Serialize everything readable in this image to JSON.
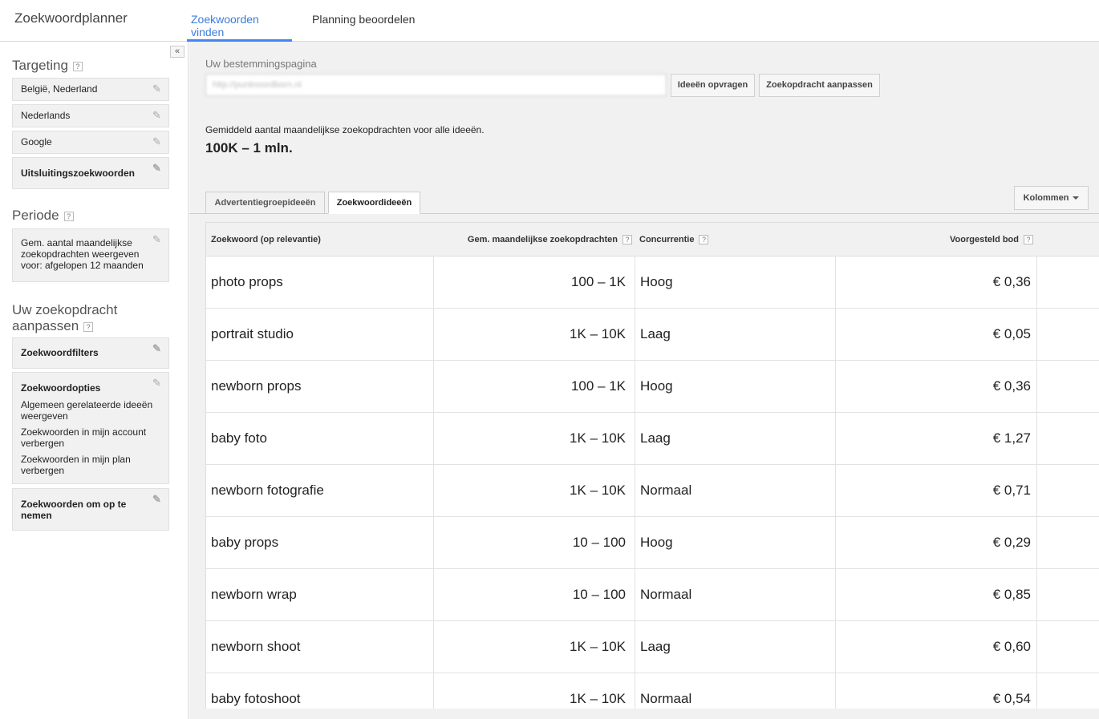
{
  "header": {
    "app_title": "Zoekwoordplanner",
    "tabs": [
      {
        "label": "Zoekwoorden vinden",
        "active": true
      },
      {
        "label": "Planning beoordelen",
        "active": false
      }
    ]
  },
  "sidebar": {
    "collapse_label": "«",
    "targeting": {
      "title": "Targeting",
      "help": "?",
      "items": [
        "België, Nederland",
        "Nederlands",
        "Google",
        "Uitsluitingszoekwoorden"
      ]
    },
    "period": {
      "title": "Periode",
      "help": "?",
      "lines": [
        "Gem. aantal maandelijkse",
        "zoekopdrachten weergeven",
        "voor: afgelopen 12 maanden"
      ]
    },
    "adjust": {
      "title_line1": "Uw zoekopdracht",
      "title_line2": "aanpassen",
      "help": "?",
      "filters_label": "Zoekwoordfilters",
      "options_label": "Zoekwoordopties",
      "options_lines": [
        [
          "Algemeen gerelateerde ideeën",
          "weergeven"
        ],
        [
          "Zoekwoorden in mijn account",
          "verbergen"
        ],
        [
          "Zoekwoorden in mijn plan",
          "verbergen"
        ]
      ],
      "include_line1": "Zoekwoorden om op te",
      "include_line2": "nemen"
    },
    "pencil_icon": "✎"
  },
  "main": {
    "landing_label": "Uw bestemmingspagina",
    "landing_value": "http://puntnoordborn.nl",
    "get_ideas_button": "Ideeën opvragen",
    "adjust_search_button": "Zoekopdracht aanpassen",
    "avg_label": "Gemiddeld aantal maandelijkse zoekopdrachten voor alle ideeën.",
    "avg_value": "100K – 1 mln.",
    "subtabs": [
      {
        "label": "Advertentiegroepideeën",
        "active": false
      },
      {
        "label": "Zoekwoordideeën",
        "active": true
      }
    ],
    "columns_button": "Kolommen"
  },
  "table": {
    "headers": {
      "keyword": "Zoekwoord (op relevantie)",
      "volume": "Gem. maandelijkse zoekopdrachten",
      "competition": "Concurrentie",
      "bid": "Voorgesteld bod",
      "help": "?"
    },
    "rows": [
      {
        "keyword": "photo props",
        "volume": "100 – 1K",
        "competition": "Hoog",
        "bid": "€ 0,36"
      },
      {
        "keyword": "portrait studio",
        "volume": "1K – 10K",
        "competition": "Laag",
        "bid": "€ 0,05"
      },
      {
        "keyword": "newborn props",
        "volume": "100 – 1K",
        "competition": "Hoog",
        "bid": "€ 0,36"
      },
      {
        "keyword": "baby foto",
        "volume": "1K – 10K",
        "competition": "Laag",
        "bid": "€ 1,27"
      },
      {
        "keyword": "newborn fotografie",
        "volume": "1K – 10K",
        "competition": "Normaal",
        "bid": "€ 0,71"
      },
      {
        "keyword": "baby props",
        "volume": "10 – 100",
        "competition": "Hoog",
        "bid": "€ 0,29"
      },
      {
        "keyword": "newborn wrap",
        "volume": "10 – 100",
        "competition": "Normaal",
        "bid": "€ 0,85"
      },
      {
        "keyword": "newborn shoot",
        "volume": "1K – 10K",
        "competition": "Laag",
        "bid": "€ 0,60"
      },
      {
        "keyword": "baby fotoshoot",
        "volume": "1K – 10K",
        "competition": "Normaal",
        "bid": "€ 0,54"
      }
    ]
  },
  "colors": {
    "accent": "#4285f4",
    "panel_bg": "#f1f1f1"
  }
}
